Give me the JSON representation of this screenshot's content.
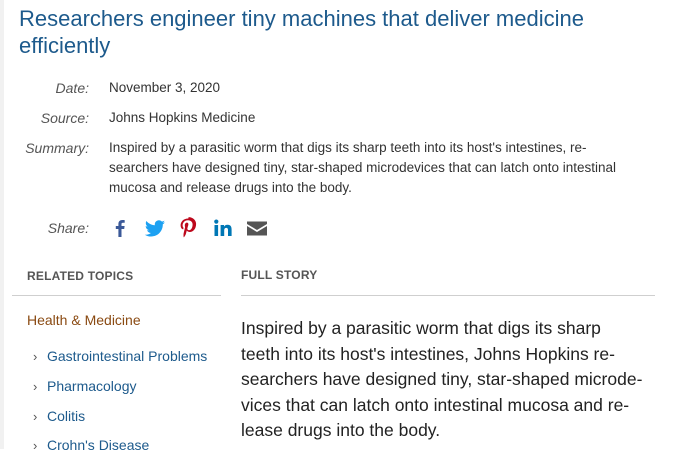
{
  "headline": "Researchers engineer tiny machines that deliver medicine efficiently",
  "meta": {
    "date_label": "Date:",
    "date": "November 3, 2020",
    "source_label": "Source:",
    "source": "Johns Hopkins Medicine",
    "summary_label": "Summary:",
    "summary_lines": [
      "Inspired by a parasitic worm that digs its sharp teeth into its host's intestines, re-",
      "searchers have designed tiny, star-shaped microdevices that can latch onto intestinal",
      "mucosa and release drugs into the body."
    ],
    "share_label": "Share:"
  },
  "share_icons": [
    {
      "name": "facebook-icon",
      "color": "#3b5998"
    },
    {
      "name": "twitter-icon",
      "color": "#1da1f2"
    },
    {
      "name": "pinterest-icon",
      "color": "#bd081c"
    },
    {
      "name": "linkedin-icon",
      "color": "#0077b5"
    },
    {
      "name": "email-icon",
      "color": "#555555"
    }
  ],
  "related_topics": {
    "heading": "RELATED TOPICS",
    "category": "Health & Medicine",
    "items": [
      "Gastrointestinal Problems",
      "Pharmacology",
      "Colitis",
      "Crohn's Disease"
    ]
  },
  "full_story": {
    "heading": "FULL STORY",
    "lines": [
      "Inspired by a parasitic worm that digs its sharp",
      "teeth into its host's intestines, Johns Hopkins re-",
      "searchers have designed tiny, star-shaped microde-",
      "vices that can latch onto intestinal mucosa and re-",
      "lease drugs into the body."
    ]
  },
  "colors": {
    "headline": "#1d5a8c",
    "link": "#1d5a8c",
    "category": "#8a4a12"
  }
}
